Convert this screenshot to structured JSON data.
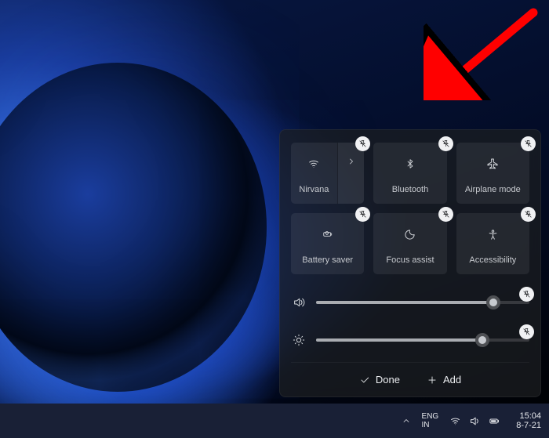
{
  "panel": {
    "tiles": {
      "wifi": {
        "label": "Nirvana"
      },
      "bluetooth": {
        "label": "Bluetooth"
      },
      "airplane": {
        "label": "Airplane mode"
      },
      "battery": {
        "label": "Battery saver"
      },
      "focus": {
        "label": "Focus assist"
      },
      "accessibility": {
        "label": "Accessibility"
      }
    },
    "sliders": {
      "volume": {
        "value": 83
      },
      "brightness": {
        "value": 78
      }
    },
    "footer": {
      "done": "Done",
      "add": "Add"
    }
  },
  "taskbar": {
    "lang_top": "ENG",
    "lang_bottom": "IN",
    "time": "15:04",
    "date": "8-7-21"
  }
}
